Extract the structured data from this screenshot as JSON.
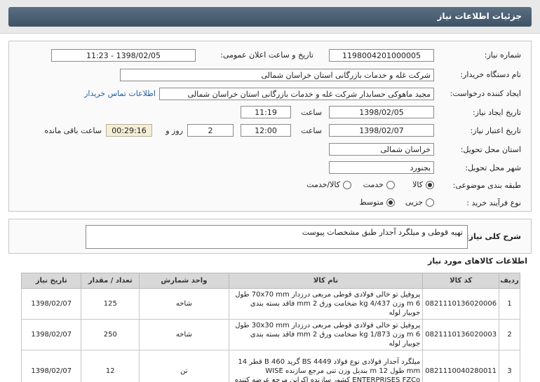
{
  "header": {
    "title": "جزئیات اطلاعات نیاز"
  },
  "form": {
    "need_number_label": "شماره نیاز:",
    "need_number": "1198004201000005",
    "announce_label": "تاریخ و ساعت اعلان عمومی:",
    "announce_value": "1398/02/05 - 11:23",
    "buyer_org_label": "نام دستگاه خریدار:",
    "buyer_org": "شرکت غله و خدمات بازرگانی استان خراسان شمالی",
    "requester_label": "ایجاد کننده درخواست:",
    "requester": "مجید ماهوکی حسابدار شرکت غله و خدمات بازرگانی استان خراسان شمالی",
    "contact_link": "اطلاعات تماس خریدار",
    "created_date_label": "تاریخ ایجاد نیاز:",
    "created_date": "1398/02/05",
    "created_time_label": "ساعت",
    "created_time": "11:19",
    "validity_label": "تاریخ اعتبار نیاز:",
    "validity_date": "1398/02/07",
    "validity_time_label": "ساعت",
    "validity_time": "12:00",
    "days_value": "2",
    "days_label": "روز و",
    "remaining_time": "00:29:16",
    "remaining_label": "ساعت باقی مانده",
    "province_label": "استان محل تحویل:",
    "province": "خراسان شمالی",
    "city_label": "شهر محل تحویل:",
    "city": "بجنورد",
    "category_label": "طبقه بندی موضوعی:",
    "category_options": [
      "کالا",
      "خدمت",
      "کالا/خدمت"
    ],
    "category_selected": "کالا",
    "process_label": "نوع فرآیند خرید :",
    "process_options": [
      "جزیی",
      "متوسط"
    ],
    "process_selected": "متوسط"
  },
  "description": {
    "label": "شرح کلی نیاز:",
    "text": "تهیه قوطی و میلگرد آجدار طبق مشخصات پیوست"
  },
  "items_section": {
    "title": "اطلاعات کالاهای مورد نیاز",
    "columns": [
      "ردیف",
      "کد کالا",
      "نام کالا",
      "واحد شمارش",
      "تعداد / مقدار",
      "تاریخ نیاز"
    ],
    "rows": [
      {
        "index": "1",
        "code": "0821110136020006",
        "name": "پروفیل تو خالی فولادی قوطی مربعی درزدار 70x70 mm طول 6 m وزن 4/437 kg ضخامت ورق 2 mm فاقد بسته بندی جوبیار لوله",
        "unit": "شاخه",
        "qty": "125",
        "date": "1398/02/07"
      },
      {
        "index": "2",
        "code": "0821110136020003",
        "name": "پروفیل تو خالی فولادی قوطی مربعی درزدار 30x30 mm طول 6 m وزن 1/873 kg ضخامت ورق 2 mm فاقد بسته بندی جوبیار لوله",
        "unit": "شاخه",
        "qty": "250",
        "date": "1398/02/07"
      },
      {
        "index": "3",
        "code": "0821110040280011",
        "name": "میلگرد آجدار فولادی نوع فولاد BS 4449 گرید 460 B قطر 14 mm طول 12 m بندیل وزن تنی مرجع سازنده WISE ENTERPRISES FZCo کشور سازنده اکراین مرجع عرضه کننده",
        "unit": "تن",
        "qty": "12",
        "date": "1398/02/07"
      }
    ]
  }
}
